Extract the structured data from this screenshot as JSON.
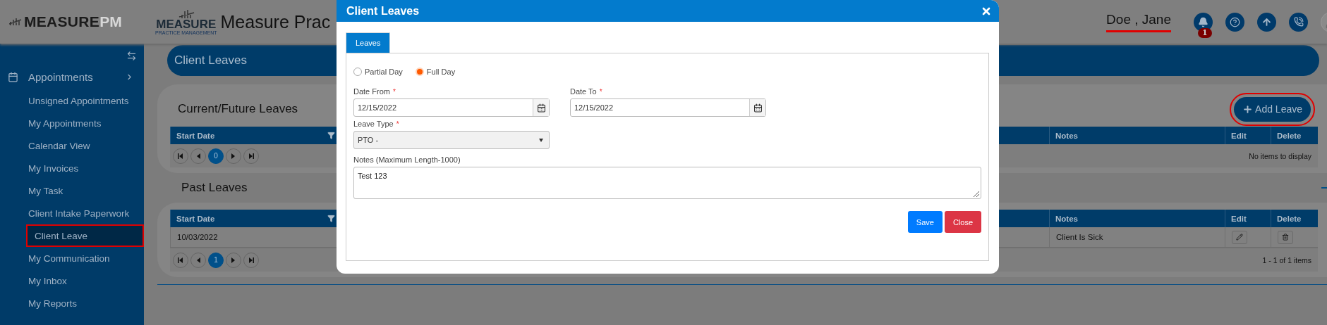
{
  "header": {
    "brand": "MEASURE",
    "brand_suffix": "PM",
    "logo_word": "MEASURE",
    "logo_tagline": "PRACTICE MANAGEMENT",
    "title": "Measure Prac",
    "user_name": "Doe , Jane",
    "user_annotated": true,
    "notification_count": "1"
  },
  "sidebar": {
    "sections": [
      {
        "label": "Appointments",
        "children": [
          {
            "label": "Unsigned Appointments",
            "selected": false,
            "annotated": false
          },
          {
            "label": "My Appointments",
            "selected": false,
            "annotated": false
          },
          {
            "label": "Calendar View",
            "selected": false,
            "annotated": false
          },
          {
            "label": "My Invoices",
            "selected": false,
            "annotated": false
          },
          {
            "label": "My Task",
            "selected": false,
            "annotated": false
          },
          {
            "label": "Client Intake Paperwork",
            "selected": false,
            "annotated": false
          },
          {
            "label": "Client Leave",
            "selected": true,
            "annotated": true
          },
          {
            "label": "My Communication",
            "selected": false,
            "annotated": false
          },
          {
            "label": "My Inbox",
            "selected": false,
            "annotated": false
          },
          {
            "label": "My Reports",
            "selected": false,
            "annotated": false
          }
        ]
      }
    ]
  },
  "page": {
    "title": "Client Leaves",
    "add_button": {
      "label": "Add Leave",
      "annotated": true
    },
    "sections": [
      {
        "heading": "Current/Future Leaves",
        "columns": [
          "Start Date",
          "Notes",
          "Edit",
          "Delete"
        ],
        "page": "0",
        "summary": "No items to display"
      },
      {
        "heading": "Past Leaves",
        "columns": [
          "Start Date",
          "Notes",
          "Edit",
          "Delete"
        ],
        "rows": [
          {
            "start_date": "10/03/2022",
            "notes": "Client Is Sick"
          }
        ],
        "page": "1",
        "summary": "1 - 1 of 1 items"
      }
    ]
  },
  "modal": {
    "title": "Client Leaves",
    "tabs": [
      {
        "label": "Leaves",
        "selected": true
      }
    ],
    "day_options": [
      {
        "label": "Partial Day",
        "selected": false
      },
      {
        "label": "Full Day",
        "selected": true
      }
    ],
    "date_from": {
      "label": "Date From",
      "required_mark": "*",
      "value": "12/15/2022"
    },
    "date_to": {
      "label": "Date To",
      "required_mark": "*",
      "value": "12/15/2022"
    },
    "leave_type": {
      "label": "Leave Type",
      "required_mark": "*",
      "value": "PTO -"
    },
    "notes": {
      "label": "Notes (Maximum Length-1000)",
      "value": "Test 123"
    },
    "buttons": [
      {
        "kind": "primary",
        "label": "Save"
      },
      {
        "kind": "danger",
        "label": "Close"
      }
    ]
  }
}
